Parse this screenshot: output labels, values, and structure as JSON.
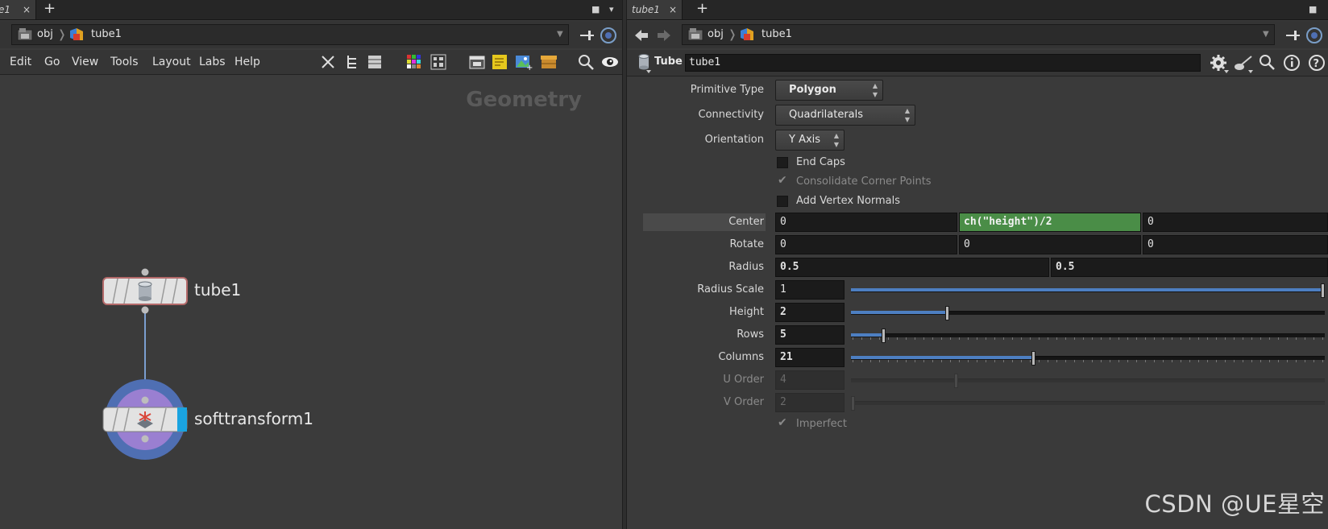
{
  "left_pane": {
    "tab": {
      "label": "e1",
      "close": "×"
    },
    "tab_add": "+",
    "tab_controls": {
      "max": "■",
      "menu": "▾"
    },
    "path": [
      {
        "label": "obj"
      },
      {
        "label": "tube1"
      }
    ],
    "menus": [
      "Edit",
      "Go",
      "View",
      "Tools",
      "Layout",
      "Labs",
      "Help"
    ],
    "context_label": "Geometry",
    "nodes": [
      {
        "name": "tube1",
        "icon": "tube-cylinder-icon"
      },
      {
        "name": "softtransform1",
        "icon": "softtransform-icon"
      }
    ]
  },
  "right_pane": {
    "tab": {
      "label": "tube1",
      "close": "×"
    },
    "tab_add": "+",
    "path": [
      {
        "label": "obj"
      },
      {
        "label": "tube1"
      }
    ],
    "node_type": "Tube",
    "node_name": "tube1",
    "params": {
      "primitive_type": {
        "label": "Primitive Type",
        "value": "Polygon"
      },
      "connectivity": {
        "label": "Connectivity",
        "value": "Quadrilaterals"
      },
      "orientation": {
        "label": "Orientation",
        "value": "Y Axis"
      },
      "end_caps": {
        "label": "End Caps",
        "checked": false
      },
      "consolidate": {
        "label": "Consolidate Corner Points",
        "checked": true,
        "disabled": true
      },
      "add_vertex_normals": {
        "label": "Add Vertex Normals",
        "checked": false
      },
      "center": {
        "label": "Center",
        "values": [
          "0",
          "ch(\"height\")/2",
          "0"
        ]
      },
      "rotate": {
        "label": "Rotate",
        "values": [
          "0",
          "0",
          "0"
        ]
      },
      "radius": {
        "label": "Radius",
        "values": [
          "0.5",
          "0.5"
        ]
      },
      "radius_scale": {
        "label": "Radius Scale",
        "value": "1",
        "fraction": 1.0
      },
      "height": {
        "label": "Height",
        "value": "2",
        "fraction": 0.2
      },
      "rows": {
        "label": "Rows",
        "value": "5",
        "fraction": 0.065
      },
      "columns": {
        "label": "Columns",
        "value": "21",
        "fraction": 0.385
      },
      "u_order": {
        "label": "U Order",
        "value": "4",
        "fraction": 0.22
      },
      "v_order": {
        "label": "V Order",
        "value": "2",
        "fraction": 0.0
      },
      "imperfect": {
        "label": "Imperfect",
        "checked": true,
        "disabled": true
      }
    }
  },
  "watermark": "CSDN @UE星空",
  "colors": {
    "expression_green": "#4a8d47",
    "slider_blue": "#4d7fc2",
    "node_blue": "#4f6fb3",
    "node_purple": "#9a7fd1"
  }
}
